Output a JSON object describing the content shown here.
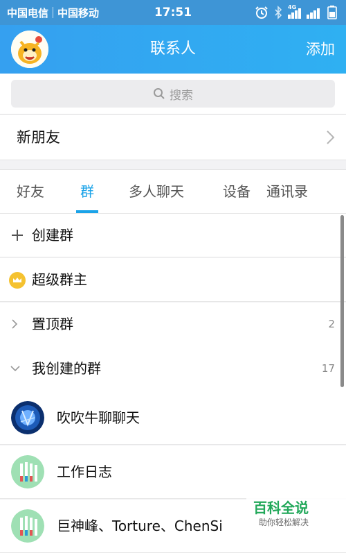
{
  "status_bar": {
    "carrier1": "中国电信",
    "carrier2": "中国移动",
    "time": "17:51",
    "network": "4G",
    "icons": [
      "alarm-icon",
      "bluetooth-icon",
      "signal-4g-icon",
      "signal-icon",
      "battery-icon"
    ]
  },
  "header": {
    "title": "联系人",
    "add_label": "添加"
  },
  "search": {
    "placeholder": "搜索"
  },
  "new_friends": {
    "label": "新朋友"
  },
  "tabs": [
    {
      "label": "好友",
      "active": false
    },
    {
      "label": "群",
      "active": true
    },
    {
      "label": "多人聊天",
      "active": false
    },
    {
      "label": "设备",
      "active": false
    },
    {
      "label": "通讯录",
      "active": false
    }
  ],
  "group_actions": {
    "create": {
      "label": "创建群"
    },
    "super_owner": {
      "label": "超级群主"
    },
    "pinned": {
      "label": "置顶群",
      "count": "2"
    },
    "created_by_me": {
      "label": "我创建的群",
      "count": "17"
    }
  },
  "groups": [
    {
      "name": "吹吹牛聊聊天"
    },
    {
      "name": "工作日志"
    },
    {
      "name": "巨神峰、Torture、ChenSi"
    }
  ],
  "watermark": {
    "title": "百科全说",
    "subtitle": "助你轻松解决"
  },
  "colors": {
    "accent": "#1ba3e8",
    "header": "#3e95d6",
    "crown": "#f5c230",
    "watermark": "#22a85a"
  }
}
